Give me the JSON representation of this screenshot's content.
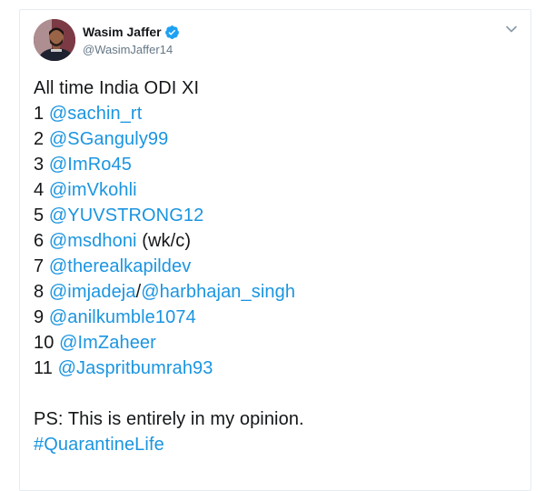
{
  "author": {
    "display_name": "Wasim Jaffer",
    "handle": "@WasimJaffer14",
    "verified": true
  },
  "icons": {
    "verified": "verified-badge-icon",
    "menu": "chevron-down-icon"
  },
  "colors": {
    "link": "#1b95e0",
    "text": "#14171a",
    "secondary": "#657786",
    "verified": "#1da1f2"
  },
  "tweet": {
    "title": "All time India ODI XI",
    "lineup": [
      {
        "num": "1",
        "mention": "@sachin_rt",
        "suffix": ""
      },
      {
        "num": "2",
        "mention": "@SGanguly99",
        "suffix": ""
      },
      {
        "num": "3",
        "mention": "@ImRo45",
        "suffix": ""
      },
      {
        "num": "4",
        "mention": "@imVkohli",
        "suffix": ""
      },
      {
        "num": "5",
        "mention": "@YUVSTRONG12",
        "suffix": ""
      },
      {
        "num": "6",
        "mention": "@msdhoni",
        "suffix": " (wk/c)"
      },
      {
        "num": "7",
        "mention": "@therealkapildev",
        "suffix": ""
      },
      {
        "num": "8",
        "mention": "@imjadeja",
        "separator": "/",
        "mention2": "@harbhajan_singh",
        "suffix": ""
      },
      {
        "num": "9",
        "mention": "@anilkumble1074",
        "suffix": ""
      },
      {
        "num": "10",
        "mention": "@ImZaheer",
        "suffix": ""
      },
      {
        "num": "11",
        "mention": "@Jaspritbumrah93",
        "suffix": ""
      }
    ],
    "ps": "PS: This is entirely in my opinion.",
    "hashtag": "#QuarantineLife"
  }
}
